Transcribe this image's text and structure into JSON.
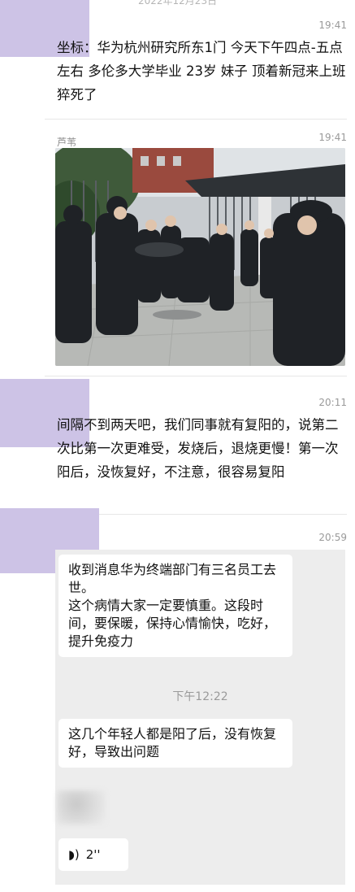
{
  "top_cut_text": "2022年12月23日",
  "posts": [
    {
      "time": "19:41",
      "text": "坐标：华为杭州研究所东1门 今天下午四点-五点左右 多伦多大学毕业 23岁 妹子 顶着新冠来上班 猝死了"
    },
    {
      "sender": "芦苇",
      "time": "19:41"
    },
    {
      "time": "20:11",
      "text": "间隔不到两天吧，我们同事就有复阳的，说第二次比第一次更难受，发烧后，退烧更慢！第一次阳后，没恢复好，不注意，很容易复阳"
    },
    {
      "time": "20:59"
    }
  ],
  "chat": {
    "bubble1": "收到消息华为终端部门有三名员工去世。\n这个病情大家一定要慎重。这段时间，要保暖，保持心情愉快，吃好，提升免疫力",
    "time_label": "下午12:22",
    "bubble2": "这几个年轻人都是阳了后，没有恢复好，导致出问题",
    "voice_duration": "2''",
    "voice_icon": "voice-wave-icon"
  },
  "colors": {
    "avatar_placeholder": "#cdc3e6",
    "chat_bg": "#ededed"
  }
}
